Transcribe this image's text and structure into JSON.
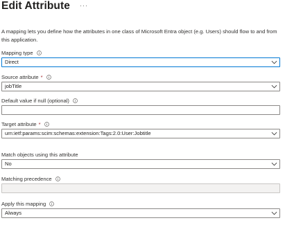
{
  "header": {
    "title": "Edit Attribute",
    "more_glyph": "···"
  },
  "description": "A mapping lets you define how the attributes in one class of Microsoft Entra object (e.g. Users) should flow to and from this application.",
  "fields": {
    "mapping_type": {
      "label": "Mapping type",
      "value": "Direct"
    },
    "source_attribute": {
      "label": "Source attribute",
      "required_mark": "*",
      "value": "jobTitle"
    },
    "default_value": {
      "label": "Default value if null (optional)",
      "value": ""
    },
    "target_attribute": {
      "label": "Target attribute",
      "required_mark": "*",
      "value": "urn:ietf:params:scim:schemas:extension:Tags:2.0:User:Jobtitle"
    },
    "match_objects": {
      "label": "Match objects using this attribute",
      "value": "No"
    },
    "matching_precedence": {
      "label": "Matching precedence",
      "value": ""
    },
    "apply_mapping": {
      "label": "Apply this mapping",
      "value": "Always"
    }
  },
  "colors": {
    "focus_border": "#0078d4",
    "required": "#a4262c",
    "border": "#8a8886",
    "disabled_bg": "#f3f2f1"
  }
}
